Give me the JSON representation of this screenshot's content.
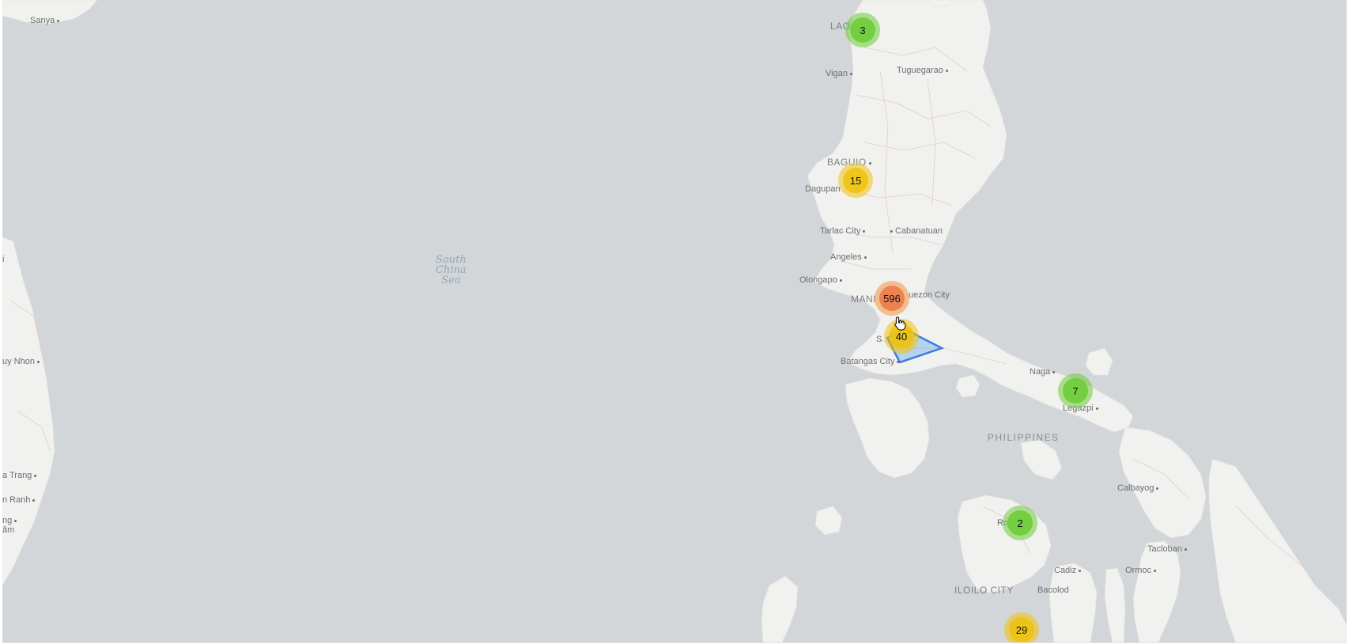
{
  "map": {
    "sea_color": "#d2d6d8",
    "land_color": "#f1f1ef",
    "sea_label": [
      "South",
      "China",
      "Sea"
    ],
    "country_label": "PHILIPPINES",
    "places": {
      "sanya": "Sanya",
      "laoag": "LAO",
      "vigan": "Vigan",
      "tuguegarao": "Tuguegarao",
      "baguio": "BAGUIO",
      "dagupan": "Dagupan",
      "tarlac": "Tarlac City",
      "cabanatuan": "Cabanatuan",
      "angeles": "Angeles",
      "olongapo": "Olongapo",
      "manila": "MANI",
      "quezon": "uezon City",
      "santa": "S",
      "batangas": "Batangas City",
      "naga": "Naga",
      "legazpi": "Legazpi",
      "calbayog": "Calbayog",
      "tacloban": "Tacloban",
      "ormoc": "Ormoc",
      "roxas": "Ro",
      "cadiz": "Cadiz",
      "iloilo": "ILOILO CITY",
      "bacolod": "Bacolod",
      "quy_nhon": "uy Nhon",
      "nha_trang": "a Trang",
      "cam_ranh": "n Ranh",
      "left_cut_1": "ng",
      "left_cut_2": "âm",
      "left_cut_3": "i"
    },
    "clusters": [
      {
        "id": "laoag",
        "count": "3",
        "size": "small"
      },
      {
        "id": "dagupan",
        "count": "15",
        "size": "medium"
      },
      {
        "id": "manila",
        "count": "596",
        "size": "large"
      },
      {
        "id": "batangas",
        "count": "40",
        "size": "medium"
      },
      {
        "id": "legazpi",
        "count": "7",
        "size": "small"
      },
      {
        "id": "roxas",
        "count": "2",
        "size": "small"
      },
      {
        "id": "iloilo",
        "count": "29",
        "size": "medium"
      }
    ],
    "highlight_color": "#3b7ddd"
  }
}
